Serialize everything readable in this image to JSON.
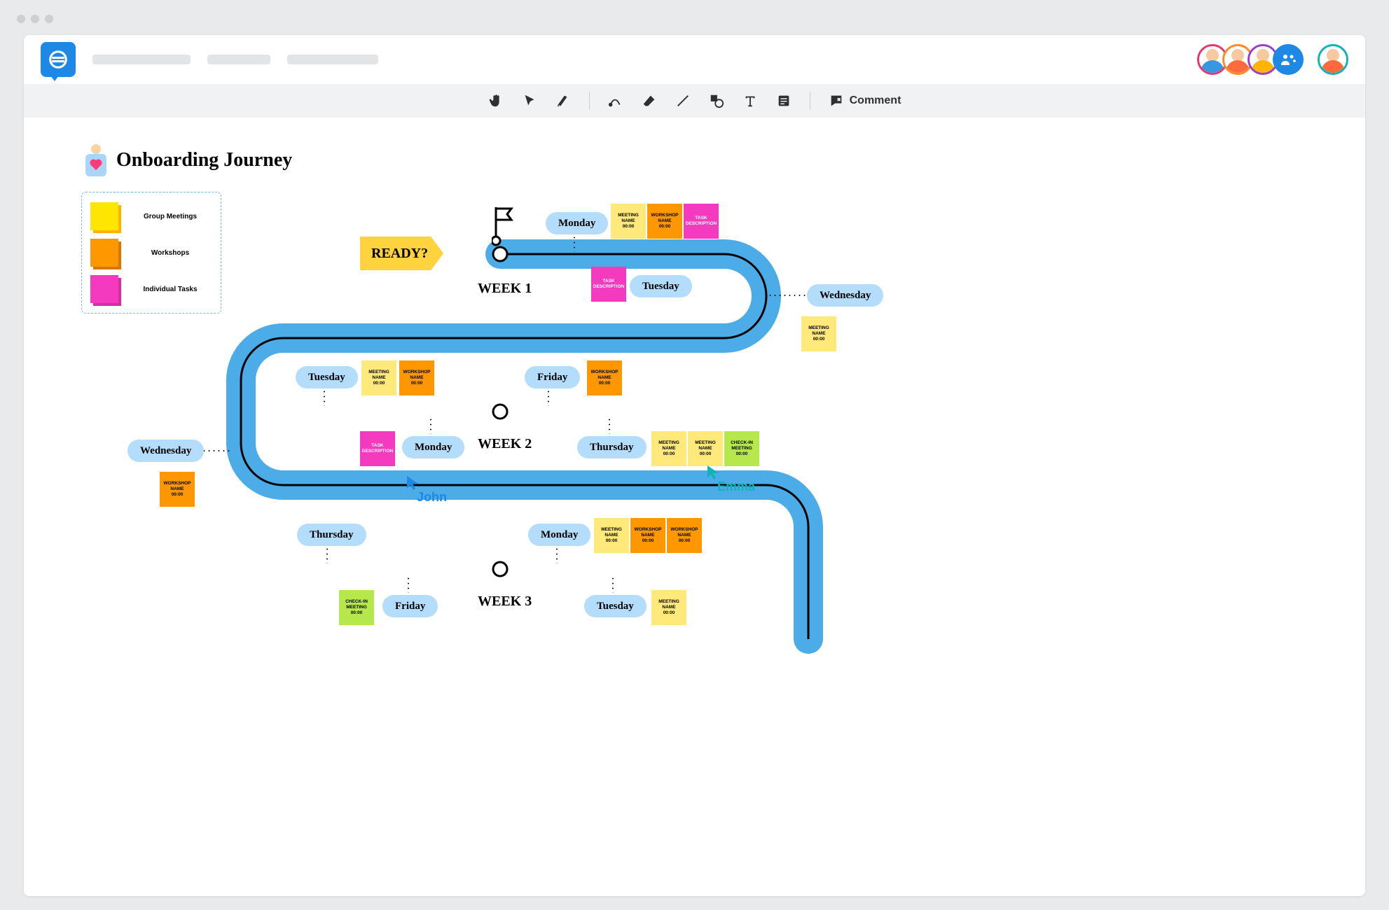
{
  "board": {
    "title": "Onboarding Journey",
    "ready": "READY?",
    "weeks": {
      "w1": "WEEK 1",
      "w2": "WEEK 2",
      "w3": "WEEK 3"
    }
  },
  "legend": {
    "items": [
      {
        "label": "Group Meetings",
        "bg": "#ffe600",
        "shadow": "#ffb400"
      },
      {
        "label": "Workshops",
        "bg": "#ff9800",
        "shadow": "#d87800"
      },
      {
        "label": "Individual Tasks",
        "bg": "#f43abf",
        "shadow": "#d22fa3"
      }
    ]
  },
  "days": {
    "w1_mon": "Monday",
    "w1_tue": "Tuesday",
    "w1_wed": "Wednesday",
    "w2_tue": "Tuesday",
    "w2_fri": "Friday",
    "w2_mon": "Monday",
    "w2_thu": "Thursday",
    "w2_wed": "Wednesday",
    "w3_thu": "Thursday",
    "w3_mon": "Monday",
    "w3_fri": "Friday",
    "w3_tue": "Tuesday"
  },
  "notes": {
    "w1_mon1": "MEETING NAME\n00:00",
    "w1_mon2": "WORKSHOP NAME\n00:00",
    "w1_mon3": "TASK DESCRIPTION",
    "w1_tue1": "TASK DESCRIPTION",
    "w1_wed1": "MEETING NAME\n00:00",
    "w2_tue1": "MEETING NAME\n00:00",
    "w2_tue2": "WORKSHOP NAME\n00:00",
    "w2_fri1": "WORKSHOP NAME\n00:00",
    "w2_mon1": "TASK DESCRIPTION",
    "w2_thu1": "MEETING NAME\n00:00",
    "w2_thu2": "MEETING NAME\n00:00",
    "w2_thu3": "CHECK-IN MEETING\n00:00",
    "w2_wed1": "WORKSHOP NAME\n00:00",
    "w3_mon1": "MEETING NAME\n00:00",
    "w3_mon2": "WORKSHOP NAME\n00:00",
    "w3_mon3": "WORKSHOP NAME\n00:00",
    "w3_fri1": "CHECK-IN MEETING\n00:00",
    "w3_tue1": "MEETING NAME\n00:00"
  },
  "cursors": {
    "john": {
      "name": "John",
      "color": "#1E88E5"
    },
    "emma": {
      "name": "Emma",
      "color": "#12b3b8"
    }
  },
  "toolbar": {
    "comment": "Comment"
  },
  "colors": {
    "road": "#4cace7",
    "yellow": "#ffe97a",
    "orange": "#ff9800",
    "pink": "#f43abf",
    "green": "#b6e84c",
    "pill": "#b3ddfa"
  }
}
